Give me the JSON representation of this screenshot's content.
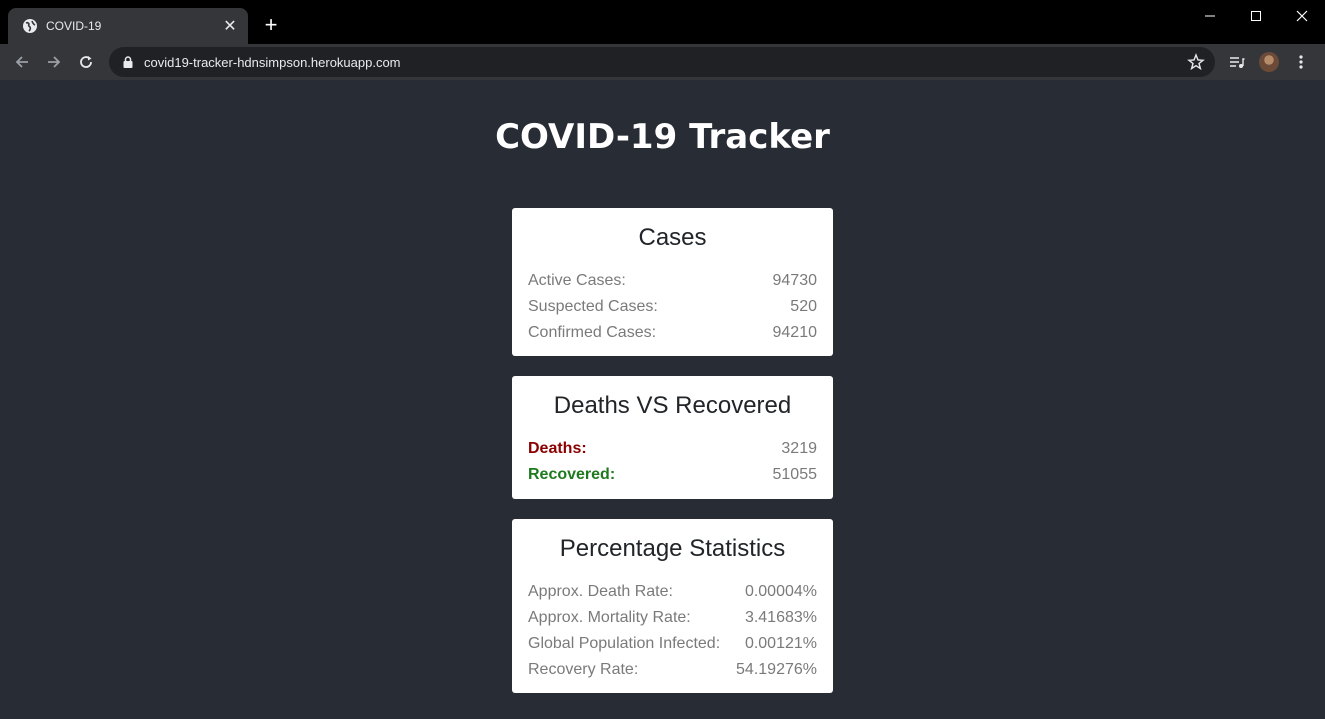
{
  "browser": {
    "tab_title": "COVID-19",
    "tab_close": "✕",
    "new_tab": "+",
    "url": "covid19-tracker-hdnsimpson.herokuapp.com"
  },
  "page": {
    "title": "COVID-19 Tracker",
    "cases": {
      "heading": "Cases",
      "rows": [
        {
          "label": "Active Cases:",
          "value": "94730"
        },
        {
          "label": "Suspected Cases:",
          "value": "520"
        },
        {
          "label": "Confirmed Cases:",
          "value": "94210"
        }
      ]
    },
    "deaths_vs_recovered": {
      "heading": "Deaths VS Recovered",
      "deaths_label": "Deaths:",
      "deaths_value": "3219",
      "recovered_label": "Recovered:",
      "recovered_value": "51055"
    },
    "percentages": {
      "heading": "Percentage Statistics",
      "rows": [
        {
          "label": "Approx. Death Rate:",
          "value": "0.00004%"
        },
        {
          "label": "Approx. Mortality Rate:",
          "value": "3.41683%"
        },
        {
          "label": "Global Population Infected:",
          "value": "0.00121%"
        },
        {
          "label": "Recovery Rate:",
          "value": "54.19276%"
        }
      ]
    }
  },
  "colors": {
    "background": "#282c34",
    "deaths": "#8b0000",
    "recovered": "#1f7a1f"
  }
}
